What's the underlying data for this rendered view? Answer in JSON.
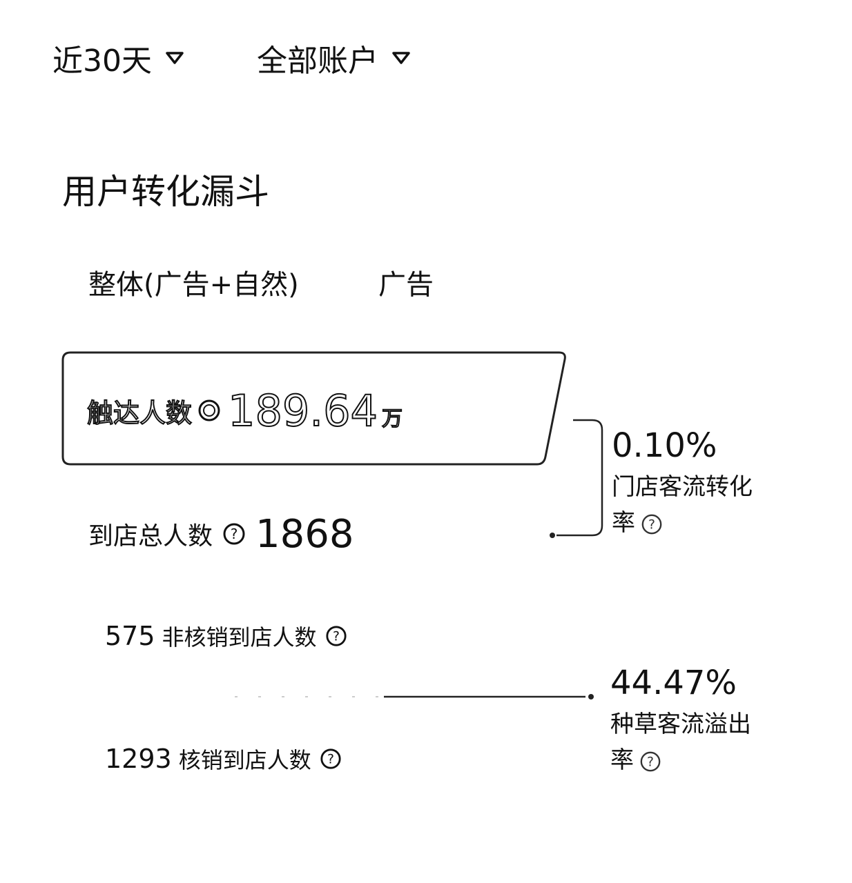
{
  "filters": {
    "date_range": "近30天",
    "account": "全部账户"
  },
  "section_title": "用户转化漏斗",
  "tabs": [
    {
      "label": "整体(广告+自然)"
    },
    {
      "label": "广告"
    }
  ],
  "funnel": {
    "reach": {
      "label": "触达人数",
      "value": "189.64",
      "unit": "万"
    },
    "store_total": {
      "label": "到店总人数",
      "value": "1868"
    },
    "store_conversion": {
      "value": "0.10%",
      "label": "门店客流转化率"
    },
    "non_verified": {
      "value": "575",
      "label": "非核销到店人数"
    },
    "verified": {
      "value": "1293",
      "label": "核销到店人数"
    },
    "grass_overflow": {
      "value": "44.47%",
      "label": "种草客流溢出率"
    }
  },
  "colors": {
    "text": "#111111",
    "background": "#ffffff",
    "border": "#222222"
  }
}
